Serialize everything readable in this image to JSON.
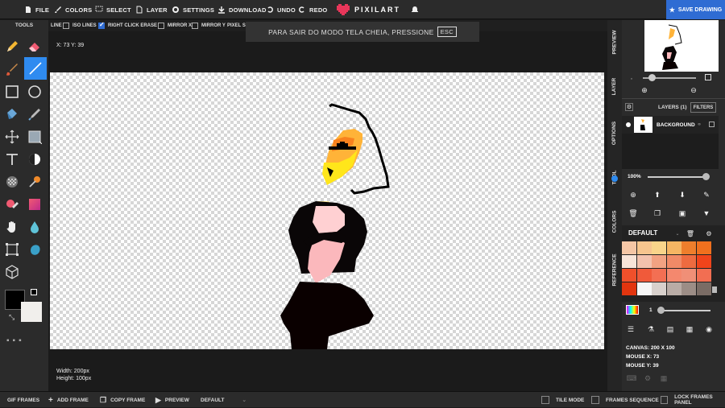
{
  "topbar": {
    "file": "FILE",
    "colors": "COLORS",
    "select": "SELECT",
    "layer": "LAYER",
    "settings": "SETTINGS",
    "download": "DOWNLOAD",
    "undo": "UNDO",
    "redo": "REDO",
    "logo": "PIXILART",
    "save": "SAVE DRAWING"
  },
  "tools": {
    "title": "TOOLS"
  },
  "options": {
    "line": "LINE",
    "iso": "ISO LINES",
    "rce": "RIGHT CLICK ERASE",
    "mirrorx": "MIRROR X",
    "mirrory": "MIRROR Y",
    "pixelsize": "PIXEL SI"
  },
  "fullscreen": {
    "message": "PARA SAIR DO MODO TELA CHEIA, PRESSIONE",
    "key": "ESC"
  },
  "status": {
    "coords": "X: 73 Y: 39",
    "width": "Width: 200px",
    "height": "Height: 100px"
  },
  "vtabs": [
    "PREVIEW",
    "LAYER",
    "OPTIONS",
    "TOOL",
    "COLORS",
    "REFERENCE"
  ],
  "layers": {
    "title": "LAYERS (1)",
    "filters": "FILTERS",
    "layer_name": "BACKGROUND",
    "opacity": "100%"
  },
  "palette": {
    "name": "DEFAULT",
    "colors": [
      "#f5c6a5",
      "#f7c58e",
      "#f9d48a",
      "#f5b563",
      "#ee7e2c",
      "#f0701e",
      "#f8e4d8",
      "#f3c2ad",
      "#f2a282",
      "#f08a67",
      "#ee6b40",
      "#f0441b",
      "#f0502b",
      "#f05a3a",
      "#f36f53",
      "#f4886e",
      "#f08f77",
      "#f26e52",
      "#e2350f",
      "#f6f6f6",
      "#d8d0cc",
      "#b9aca6",
      "#9c8d86",
      "#7a6c65"
    ],
    "size": "1"
  },
  "info": {
    "canvas": "CANVAS: 200 X 100",
    "mousex": "MOUSE X: 73",
    "mousey": "MOUSE Y: 39"
  },
  "bottom": {
    "gif": "GIF FRAMES",
    "add": "ADD FRAME",
    "copy": "COPY FRAME",
    "preview": "PREVIEW",
    "default": "DEFAULT",
    "tile": "TILE MODE",
    "seq": "FRAMES SEQUENCE",
    "lock": "LOCK FRAMES PANEL"
  },
  "accent": "#2f8bf0"
}
